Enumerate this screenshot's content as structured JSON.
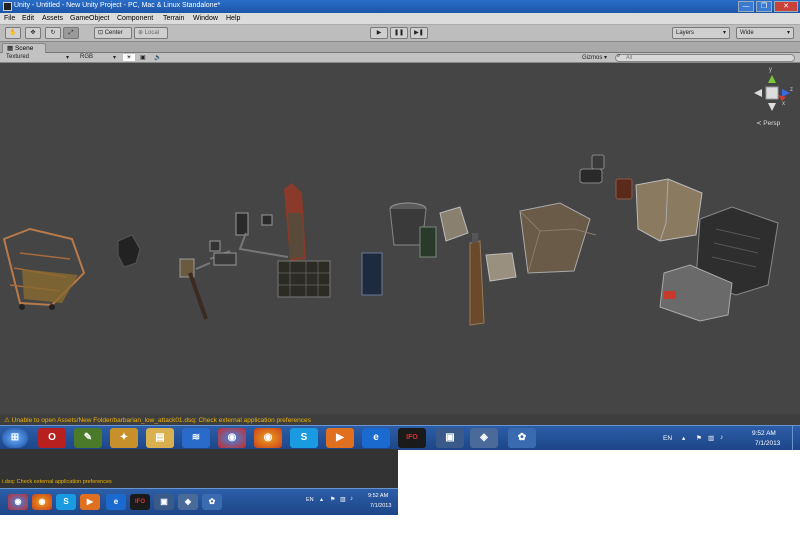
{
  "window": {
    "title": "Unity - Untitled - New Unity Project - PC, Mac & Linux Standalone*",
    "min": "—",
    "max": "❐",
    "close": "✕"
  },
  "menu": {
    "items": [
      "File",
      "Edit",
      "Assets",
      "GameObject",
      "Component",
      "Terrain",
      "Window",
      "Help"
    ]
  },
  "toolbar": {
    "tools": [
      "hand-tool-icon",
      "move-tool-icon",
      "rotate-tool-icon",
      "scale-tool-icon"
    ],
    "pivot_label": "Center",
    "space_label": "Local",
    "play": "▶",
    "pause": "❚❚",
    "step": "▶❚",
    "layers_label": "Layers",
    "layout_label": "Wide"
  },
  "scene": {
    "tab_label": "Scene",
    "render_mode": "Textured",
    "color_mode": "RGB",
    "gizmos_label": "Gizmos",
    "search_placeholder": "All",
    "persp_label": "Persp",
    "axis_y": "y",
    "axis_x": "x",
    "axis_z": "z"
  },
  "console": {
    "message": "Unable to open Assets/New Folder/barbarian_low_attack01.dsq: Check external application preferences",
    "message_truncated": "i.dsq: Check external application preferences"
  },
  "taskbar": {
    "lang": "EN",
    "time": "9:52 AM",
    "date": "7/1/2013",
    "icons": [
      "O",
      "S",
      "e",
      "IFO"
    ],
    "sub_lang": "EN"
  },
  "colors": {
    "viewport": "#454545",
    "warning": "#f0b400",
    "taskbar": "#1d4688"
  }
}
